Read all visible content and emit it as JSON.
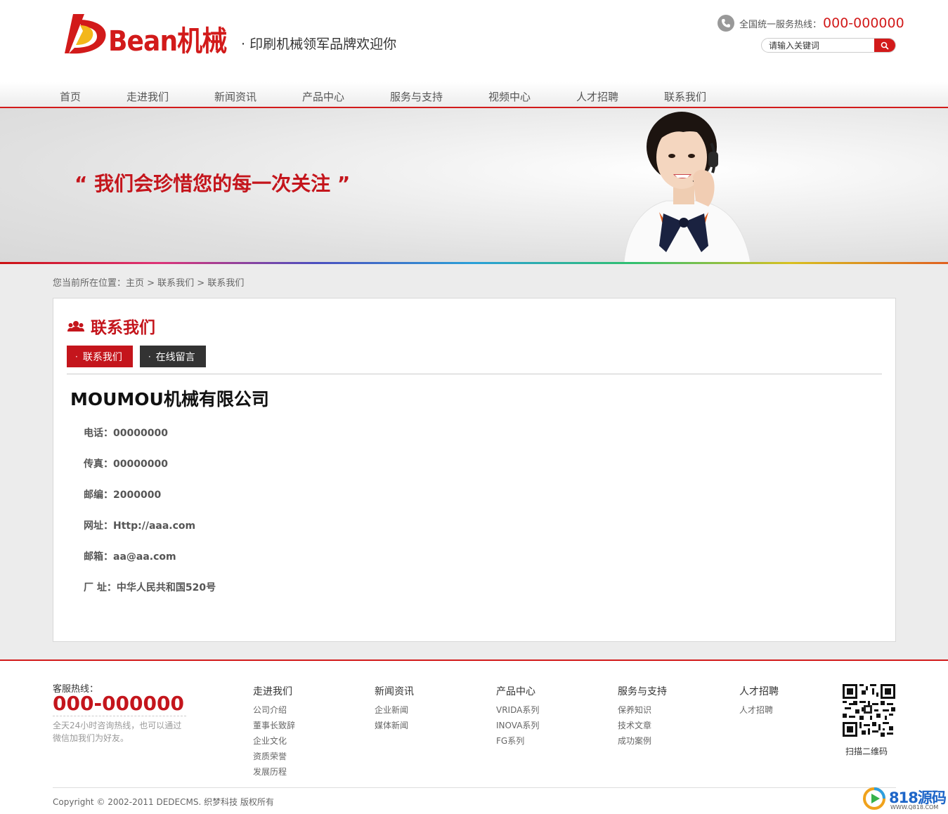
{
  "header": {
    "logo_text": "Bean机械",
    "slogan": "· 印刷机械领军品牌欢迎你",
    "hotline_label": "全国统一服务热线：",
    "hotline_number": "000-000000",
    "search_placeholder": "请输入关键词"
  },
  "nav": [
    {
      "label": "首页"
    },
    {
      "label": "走进我们"
    },
    {
      "label": "新闻资讯"
    },
    {
      "label": "产品中心"
    },
    {
      "label": "服务与支持"
    },
    {
      "label": "视频中心"
    },
    {
      "label": "人才招聘"
    },
    {
      "label": "联系我们"
    }
  ],
  "banner": {
    "text": "“ 我们会珍惜您的每一次关注 ”"
  },
  "breadcrumb": "您当前所在位置：主页 > 联系我们 > 联系我们",
  "content": {
    "section_title": "联系我们",
    "tabs": [
      {
        "label": "联系我们",
        "active": true
      },
      {
        "label": "在线留言",
        "active": false
      }
    ],
    "company": "MOUMOU机械有限公司",
    "info": [
      {
        "text": "电话：00000000"
      },
      {
        "text": "传真：00000000"
      },
      {
        "text": "邮编：2000000"
      },
      {
        "text": "网址：Http://aaa.com"
      },
      {
        "text": "邮箱：aa@aa.com"
      },
      {
        "text": "厂 址：中华人民共和国520号"
      }
    ]
  },
  "footer": {
    "hotline_label": "客服热线：",
    "hotline_number": "000-000000",
    "note": "全天24小时咨询热线，也可以通过微信加我们为好友。",
    "columns": [
      {
        "title": "走进我们",
        "links": [
          "公司介绍",
          "董事长致辞",
          "企业文化",
          "资质荣誉",
          "发展历程"
        ]
      },
      {
        "title": "新闻资讯",
        "links": [
          "企业新闻",
          "媒体新闻"
        ]
      },
      {
        "title": "产品中心",
        "links": [
          "VRIDA系列",
          "INOVA系列",
          "FG系列"
        ]
      },
      {
        "title": "服务与支持",
        "links": [
          "保养知识",
          "技术文章",
          "成功案例"
        ]
      },
      {
        "title": "人才招聘",
        "links": [
          "人才招聘"
        ]
      }
    ],
    "qr_label": "扫描二维码",
    "copyright": "Copyright © 2002-2011 DEDECMS. 织梦科技 版权所有",
    "watermark": "818源码",
    "watermark_sub": "WWW.Q818.COM"
  },
  "colors": {
    "brand_red": "#d21a1a",
    "dark_tab": "#333333"
  }
}
